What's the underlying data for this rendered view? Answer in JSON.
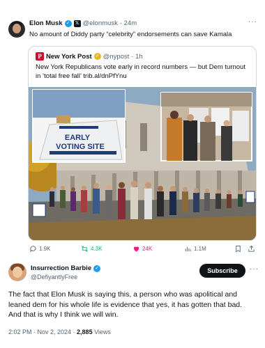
{
  "top_tweet": {
    "name": "Elon Musk",
    "handle": "@elonmusk",
    "time": "· 24m",
    "text": "No amount of Diddy party “celebrity” endorsements can save Kamala",
    "x_badge": "𝕏"
  },
  "quote": {
    "name": "New York Post",
    "handle": "@nypost",
    "time": "· 1h",
    "logo_letter": "P",
    "text": "New York Republicans vote early in record numbers — but Dem turnout in ‘total free fall’ trib.al/dnPfYnu",
    "sign_line1": "EARLY",
    "sign_line2": "VOTING SITE"
  },
  "actions": {
    "replies": "1.9K",
    "reposts": "4.3K",
    "likes": "24K",
    "views": "1.1M"
  },
  "reply": {
    "name": "Insurrection Barbie",
    "handle": "@DefiyantlyFree",
    "subscribe_label": "Subscribe",
    "text": "The fact that Elon Musk is saying this, a person who was apolitical and leaned dem for his whole life is evidence that yes, it has gotten that bad. And that is why I think we will win.",
    "timestamp": "2:02 PM · Nov 2, 2024 · ",
    "views_count": "2,885",
    "views_label": " Views"
  },
  "colors": {
    "accent": "#1d9bf0",
    "repost": "#00ba7c",
    "like": "#f91880",
    "nyp_red": "#c8102e"
  },
  "icons": [
    "verified-icon",
    "x-premium-icon",
    "reply-icon",
    "repost-icon",
    "like-icon",
    "views-icon",
    "bookmark-icon",
    "share-icon",
    "more-icon"
  ]
}
